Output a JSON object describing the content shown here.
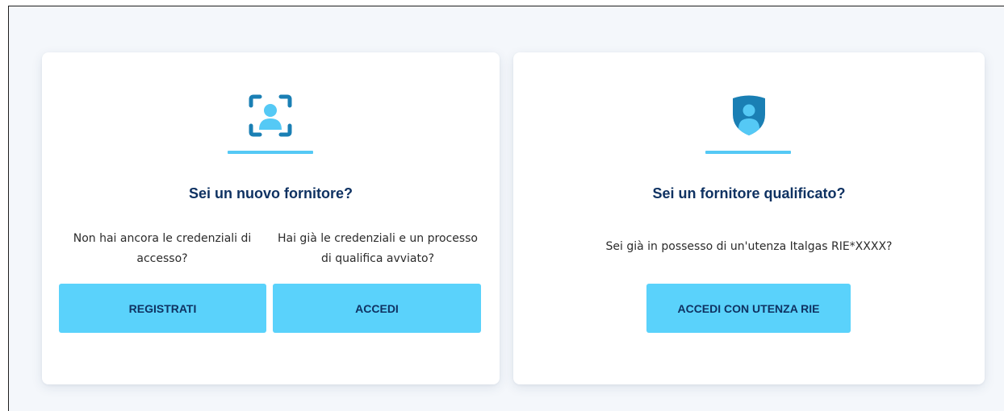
{
  "new_supplier": {
    "icon": "user-scan-icon",
    "title": "Sei un nuovo fornitore?",
    "left_desc": "Non hai ancora le credenziali di accesso?",
    "right_desc": "Hai già le credenziali e un processo di qualifica avviato?",
    "register_label": "REGISTRATI",
    "login_label": "ACCEDI"
  },
  "qualified_supplier": {
    "icon": "user-shield-icon",
    "title": "Sei un fornitore qualificato?",
    "desc": "Sei già in possesso di un'utenza Italgas RIE*XXXX?",
    "login_label": "ACCEDI CON UTENZA RIE"
  },
  "colors": {
    "accent": "#55c9f5",
    "button": "#5ad2fb",
    "title": "#0f3262",
    "icon_dark": "#1a7fb4"
  }
}
